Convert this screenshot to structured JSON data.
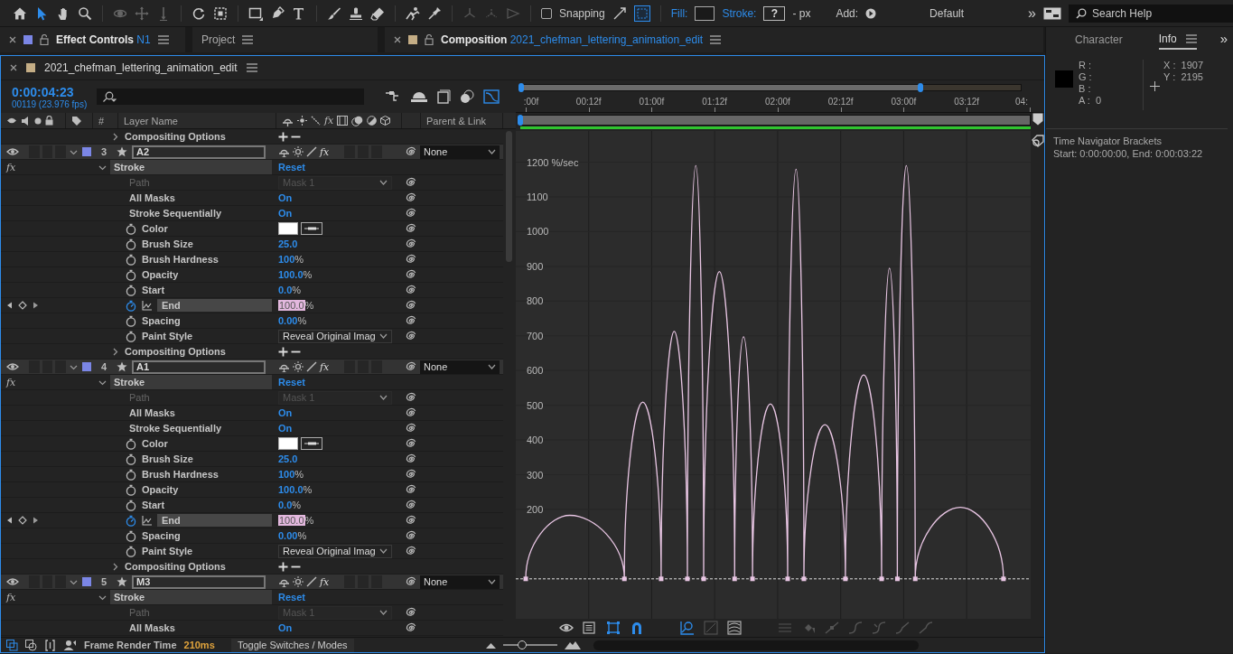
{
  "toolbar": {
    "tools": [
      {
        "kind": "home",
        "selected": false,
        "disabled": false
      },
      {
        "kind": "selection",
        "selected": true,
        "disabled": false
      },
      {
        "kind": "hand",
        "selected": false,
        "disabled": false
      },
      {
        "kind": "zoom",
        "selected": false,
        "disabled": false
      },
      {
        "kind": "orbit",
        "selected": false,
        "disabled": true
      },
      {
        "kind": "pan",
        "selected": false,
        "disabled": true
      },
      {
        "kind": "dolly",
        "selected": false,
        "disabled": true
      },
      {
        "kind": "rotate",
        "selected": false,
        "disabled": false
      },
      {
        "kind": "region",
        "selected": false,
        "disabled": false
      },
      {
        "kind": "rectangle",
        "selected": false,
        "disabled": false
      },
      {
        "kind": "pen",
        "selected": false,
        "disabled": false
      },
      {
        "kind": "type",
        "selected": false,
        "disabled": false
      },
      {
        "kind": "brush",
        "selected": false,
        "disabled": false
      },
      {
        "kind": "stamp",
        "selected": false,
        "disabled": false
      },
      {
        "kind": "eraser",
        "selected": false,
        "disabled": false
      },
      {
        "kind": "roto",
        "selected": false,
        "disabled": false
      },
      {
        "kind": "puppet",
        "selected": false,
        "disabled": false
      }
    ],
    "snapping": {
      "label": "Snapping",
      "checked": false
    },
    "fill_label": "Fill:",
    "stroke_label": "Stroke:",
    "stroke_value": "?",
    "stroke_width": "- px",
    "add_label": "Add:",
    "workspace": "Default",
    "overflow": "»",
    "search": {
      "placeholder": "Search Help"
    }
  },
  "tabs": [
    {
      "label": "Effect Controls",
      "suffix": "N1",
      "color": "#7b86e6",
      "selected": true
    },
    {
      "label": "Project",
      "selected": false
    },
    {
      "label": "Composition",
      "suffix": "2021_chefman_lettering_animation_edit",
      "color": "#c4ad85",
      "selected": true
    }
  ],
  "timeline": {
    "title": "2021_chefman_lettering_animation_edit",
    "color": "#c4ad85",
    "timecode": "0:00:04:23",
    "frame_info": "00119 (23.976 fps)",
    "columns": {
      "number": "#",
      "layer_name": "Layer Name",
      "fx": "fx",
      "parent": "Parent & Link"
    },
    "rows": [
      {
        "kind": "group",
        "label": "Compositing Options"
      },
      {
        "kind": "layer",
        "number": "3",
        "name": "A2",
        "parent": "None",
        "fx": "fx",
        "effects_on": true,
        "visible": true,
        "color": "#7b86e6"
      },
      {
        "kind": "effect",
        "badge": "fx",
        "label": "Stroke",
        "value": "Reset"
      },
      {
        "kind": "dropdown",
        "label": "Path",
        "value": "Mask 1",
        "disabled": true,
        "selected": false
      },
      {
        "kind": "link",
        "label": "All Masks",
        "value": "On",
        "disabled": false,
        "selected": false
      },
      {
        "kind": "link",
        "label": "Stroke Sequentially",
        "value": "On",
        "disabled": false,
        "selected": false
      },
      {
        "kind": "color",
        "label": "Color",
        "disabled": false,
        "stopwatch": true,
        "animated": false,
        "selected": false
      },
      {
        "kind": "number",
        "label": "Brush Size",
        "value": "25.0",
        "disabled": false,
        "stopwatch": true,
        "animated": false,
        "selected": false
      },
      {
        "kind": "number",
        "label": "Brush Hardness",
        "value": "100",
        "unit": "%",
        "disabled": false,
        "stopwatch": true,
        "animated": false,
        "selected": false
      },
      {
        "kind": "number",
        "label": "Opacity",
        "value": "100.0",
        "unit": "%",
        "disabled": false,
        "stopwatch": true,
        "animated": false,
        "selected": false
      },
      {
        "kind": "number",
        "label": "Start",
        "value": "0.0",
        "unit": "%",
        "disabled": false,
        "stopwatch": true,
        "animated": false,
        "selected": false
      },
      {
        "kind": "number",
        "label": "End",
        "value": "100.0",
        "unit": "%",
        "disabled": false,
        "stopwatch": true,
        "animated": true,
        "selected": true
      },
      {
        "kind": "number",
        "label": "Spacing",
        "value": "0.00",
        "unit": "%",
        "disabled": false,
        "stopwatch": true,
        "animated": false,
        "selected": false
      },
      {
        "kind": "dropdown",
        "label": "Paint Style",
        "value": "Reveal Original Imag",
        "disabled": false,
        "stopwatch": true,
        "animated": false,
        "selected": false
      },
      {
        "kind": "group",
        "label": "Compositing Options"
      },
      {
        "kind": "layer",
        "number": "4",
        "name": "A1",
        "parent": "None",
        "fx": "fx",
        "effects_on": true,
        "visible": true,
        "color": "#7b86e6"
      },
      {
        "kind": "effect",
        "badge": "fx",
        "label": "Stroke",
        "value": "Reset"
      },
      {
        "kind": "dropdown",
        "label": "Path",
        "value": "Mask 1",
        "disabled": true,
        "selected": false
      },
      {
        "kind": "link",
        "label": "All Masks",
        "value": "On",
        "disabled": false,
        "selected": false
      },
      {
        "kind": "link",
        "label": "Stroke Sequentially",
        "value": "On",
        "disabled": false,
        "selected": false
      },
      {
        "kind": "color",
        "label": "Color",
        "disabled": false,
        "stopwatch": true,
        "animated": false,
        "selected": false
      },
      {
        "kind": "number",
        "label": "Brush Size",
        "value": "25.0",
        "disabled": false,
        "stopwatch": true,
        "animated": false,
        "selected": false
      },
      {
        "kind": "number",
        "label": "Brush Hardness",
        "value": "100",
        "unit": "%",
        "disabled": false,
        "stopwatch": true,
        "animated": false,
        "selected": false
      },
      {
        "kind": "number",
        "label": "Opacity",
        "value": "100.0",
        "unit": "%",
        "disabled": false,
        "stopwatch": true,
        "animated": false,
        "selected": false
      },
      {
        "kind": "number",
        "label": "Start",
        "value": "0.0",
        "unit": "%",
        "disabled": false,
        "stopwatch": true,
        "animated": false,
        "selected": false
      },
      {
        "kind": "number",
        "label": "End",
        "value": "100.0",
        "unit": "%",
        "disabled": false,
        "stopwatch": true,
        "animated": true,
        "selected": true
      },
      {
        "kind": "number",
        "label": "Spacing",
        "value": "0.00",
        "unit": "%",
        "disabled": false,
        "stopwatch": true,
        "animated": false,
        "selected": false
      },
      {
        "kind": "dropdown",
        "label": "Paint Style",
        "value": "Reveal Original Imag",
        "disabled": false,
        "stopwatch": true,
        "animated": false,
        "selected": false
      },
      {
        "kind": "group",
        "label": "Compositing Options"
      },
      {
        "kind": "layer",
        "number": "5",
        "name": "M3",
        "parent": "None",
        "fx": "fx",
        "effects_on": true,
        "visible": true,
        "color": "#7b86e6"
      },
      {
        "kind": "effect",
        "badge": "fx",
        "label": "Stroke",
        "value": "Reset"
      },
      {
        "kind": "dropdown",
        "label": "Path",
        "value": "Mask 1",
        "disabled": true,
        "selected": false
      },
      {
        "kind": "link",
        "label": "All Masks",
        "value": "On",
        "disabled": false,
        "selected": false
      }
    ],
    "navigator": {
      "level": 0.8
    },
    "graph": {
      "chart_data": {
        "type": "line",
        "x": [
          0,
          0.35,
          0.783,
          0.929,
          1.075,
          1.179,
          1.283,
          1.35,
          1.4125,
          1.5375,
          1.658,
          1.729,
          1.8,
          1.942,
          2.079,
          2.146,
          2.208,
          2.375,
          2.5375,
          2.683,
          2.825,
          2.8875,
          2.95,
          3.021,
          3.092,
          3.45,
          3.792
        ],
        "grid": true,
        "ref_lines": [
          {
            "axis": "y",
            "value": 0
          }
        ],
        "series": [
          {
            "color": "#e9c6e4",
            "values": [
              0,
              183,
              0,
              509,
              0,
              713,
              0,
              1190,
              0,
              885,
              0,
              697,
              0,
              504,
              0,
              1180,
              0,
              444,
              0,
              587,
              0,
              895,
              0,
              1190,
              0,
              206,
              0
            ]
          }
        ],
        "xlim": [
          -0.079,
          4.008
        ],
        "ylim": [
          -128,
          1290
        ],
        "xticks": [
          {
            "value": 0,
            "label": ":00f"
          },
          {
            "value": 0.5,
            "label": "00:12f"
          },
          {
            "value": 1,
            "label": "01:00f"
          },
          {
            "value": 1.5,
            "label": "01:12f"
          },
          {
            "value": 2,
            "label": "02:00f"
          },
          {
            "value": 2.5,
            "label": "02:12f"
          },
          {
            "value": 3,
            "label": "03:00f"
          },
          {
            "value": 3.5,
            "label": "03:12f"
          },
          {
            "value": 4,
            "label": "04:"
          }
        ],
        "yticks": [
          200,
          300,
          400,
          500,
          600,
          700,
          800,
          900,
          1000,
          1100,
          {
            "value": 1200,
            "label": "1200 %/sec"
          }
        ]
      }
    },
    "status": {
      "label": "Frame Render Time",
      "value": "210ms",
      "toggle": "Toggle Switches / Modes",
      "zoom": {
        "level": 0.35
      }
    }
  },
  "info_panel": {
    "tabs": [
      {
        "label": "Character",
        "selected": false
      },
      {
        "label": "Info",
        "selected": true
      }
    ],
    "overflow": "»",
    "channels": [
      {
        "label": "R :"
      },
      {
        "label": "G :"
      },
      {
        "label": "B :"
      },
      {
        "label": "A :",
        "value": "0"
      }
    ],
    "coords": [
      {
        "label": "X :",
        "value": "1907"
      },
      {
        "label": "Y :",
        "value": "2195"
      }
    ],
    "note_title": "Time Navigator Brackets",
    "note": "Start: 0:00:00:00, End: 0:00:03:22"
  }
}
